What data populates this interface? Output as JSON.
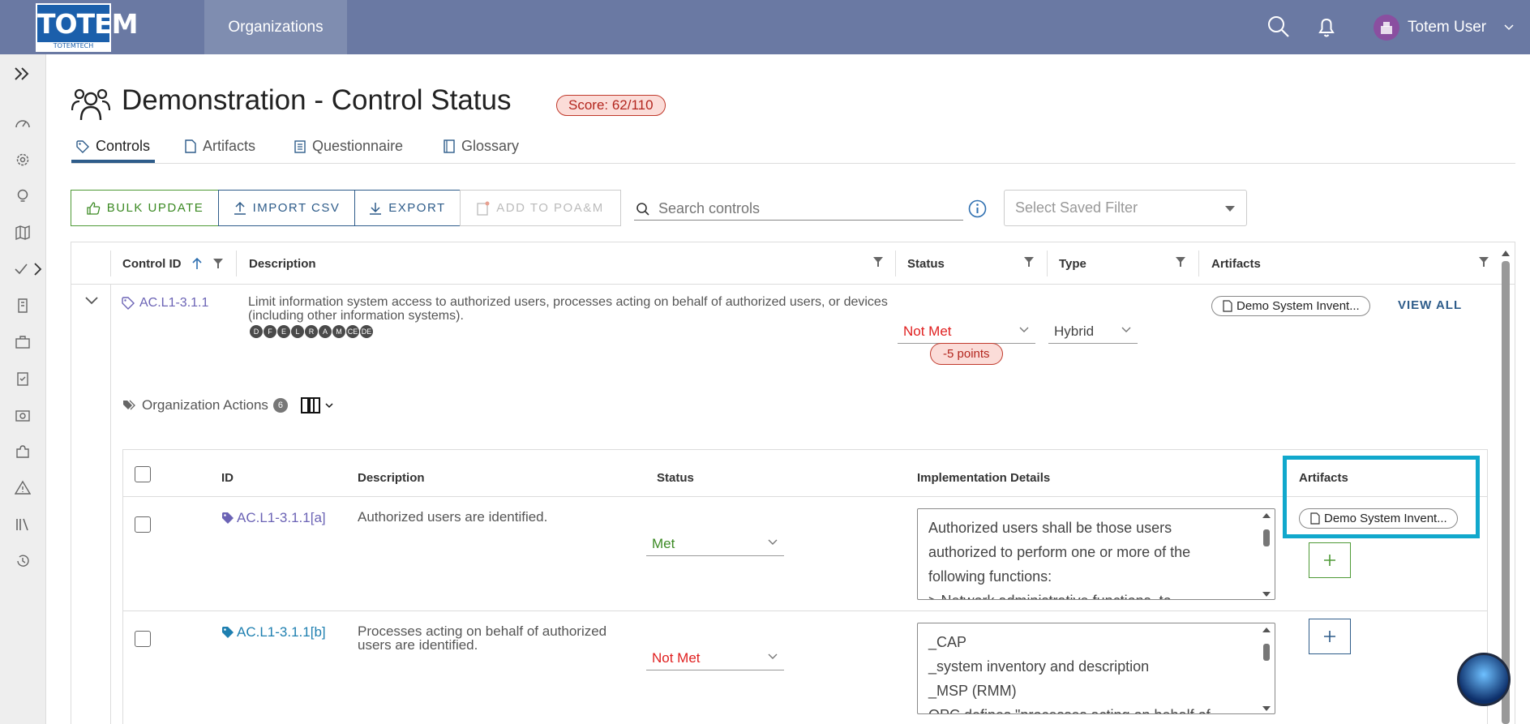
{
  "app": {
    "logo_text": "TOTEM",
    "logo_sub": "TOTEMTECH"
  },
  "topnav": {
    "organizations": "Organizations",
    "user_name": "Totem User"
  },
  "page": {
    "title": "Demonstration - Control Status",
    "score": "Score: 62/110"
  },
  "tabs": [
    {
      "label": "Controls"
    },
    {
      "label": "Artifacts"
    },
    {
      "label": "Questionnaire"
    },
    {
      "label": "Glossary"
    }
  ],
  "toolbar": {
    "bulk_update": "BULK UPDATE",
    "import_csv": "IMPORT CSV",
    "export": "EXPORT",
    "add_to_poam": "ADD TO POA&M",
    "search_placeholder": "Search controls",
    "saved_filter_placeholder": "Select Saved Filter"
  },
  "grid": {
    "headers": {
      "control_id": "Control ID",
      "description": "Description",
      "status": "Status",
      "type": "Type",
      "artifacts": "Artifacts"
    },
    "row": {
      "control_id": "AC.L1-3.1.1",
      "description": "Limit information system access to authorized users, processes acting on behalf of authorized users, or devices (including other information systems).",
      "badges": [
        "D",
        "F",
        "E",
        "L",
        "R",
        "A",
        "M",
        "CE",
        "DE"
      ],
      "status": "Not Met",
      "points": "-5 points",
      "type": "Hybrid",
      "artifact": "Demo System Invent...",
      "view_all": "VIEW ALL"
    }
  },
  "org_actions": {
    "label": "Organization Actions",
    "count": "6"
  },
  "subtable": {
    "headers": {
      "id": "ID",
      "description": "Description",
      "status": "Status",
      "impl": "Implementation Details",
      "artifacts": "Artifacts"
    },
    "rows": [
      {
        "id": "AC.L1-3.1.1[a]",
        "description": "Authorized users are identified.",
        "status": "Met",
        "impl": [
          "Authorized users shall be those users",
          "authorized to perform one or more of the",
          "following functions:",
          "> Network administrative functions, to"
        ],
        "artifact": "Demo System Invent..."
      },
      {
        "id": "AC.L1-3.1.1[b]",
        "description_l1": "Processes acting on behalf of authorized",
        "description_l2": "users are identified.",
        "status": "Not Met",
        "impl": [
          "_CAP",
          "_system inventory and description",
          "_MSP (RMM)",
          "OPC defines \"processes acting on behalf of"
        ]
      }
    ]
  },
  "colors": {
    "topbar": "#6a79a3",
    "accent_blue": "#2e5c8a",
    "met_green": "#3c8a24",
    "not_met_red": "#e02020",
    "highlight": "#11a8cc"
  }
}
